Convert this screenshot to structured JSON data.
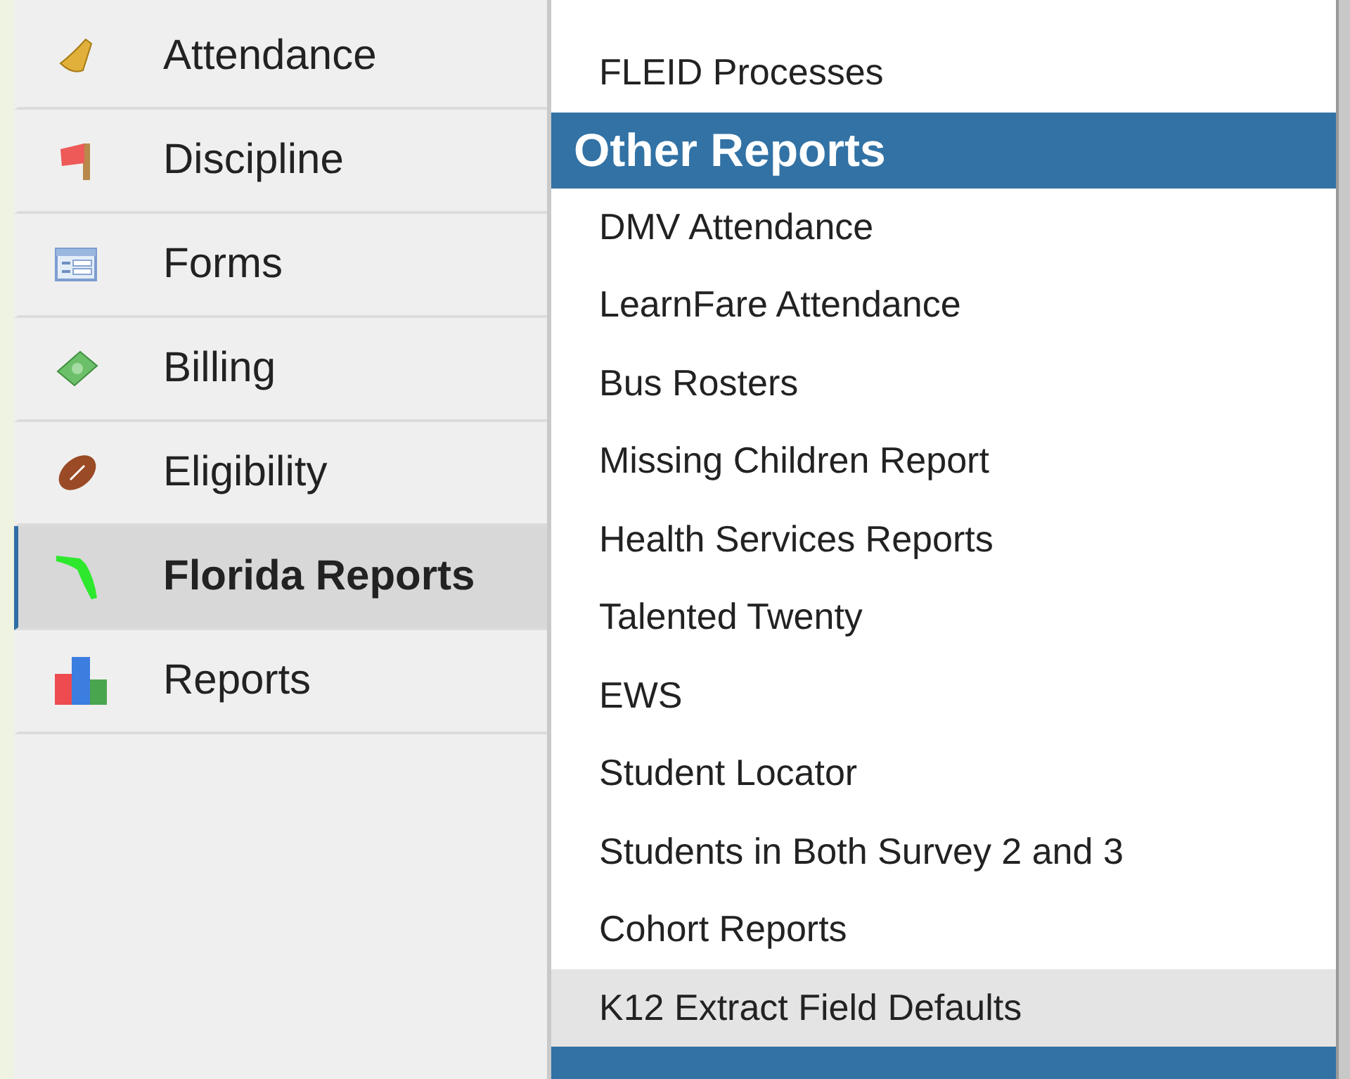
{
  "sidebar": {
    "items": [
      {
        "label": "Attendance",
        "selected": false
      },
      {
        "label": "Discipline",
        "selected": false
      },
      {
        "label": "Forms",
        "selected": false
      },
      {
        "label": "Billing",
        "selected": false
      },
      {
        "label": "Eligibility",
        "selected": false
      },
      {
        "label": "Florida Reports",
        "selected": true
      },
      {
        "label": "Reports",
        "selected": false
      }
    ]
  },
  "menu": {
    "items": [
      {
        "kind": "item",
        "label": "FLEID Processes",
        "selected": false
      },
      {
        "kind": "header",
        "label": "Other Reports"
      },
      {
        "kind": "item",
        "label": "DMV Attendance",
        "selected": false
      },
      {
        "kind": "item",
        "label": "LearnFare Attendance",
        "selected": false
      },
      {
        "kind": "item",
        "label": "Bus Rosters",
        "selected": false
      },
      {
        "kind": "item",
        "label": "Missing Children Report",
        "selected": false
      },
      {
        "kind": "item",
        "label": "Health Services Reports",
        "selected": false
      },
      {
        "kind": "item",
        "label": "Talented Twenty",
        "selected": false
      },
      {
        "kind": "item",
        "label": "EWS",
        "selected": false
      },
      {
        "kind": "item",
        "label": "Student Locator",
        "selected": false
      },
      {
        "kind": "item",
        "label": "Students in Both Survey 2 and 3",
        "selected": false
      },
      {
        "kind": "item",
        "label": "Cohort Reports",
        "selected": false
      },
      {
        "kind": "item",
        "label": "K12 Extract Field Defaults",
        "selected": true
      },
      {
        "kind": "header"
      }
    ]
  }
}
